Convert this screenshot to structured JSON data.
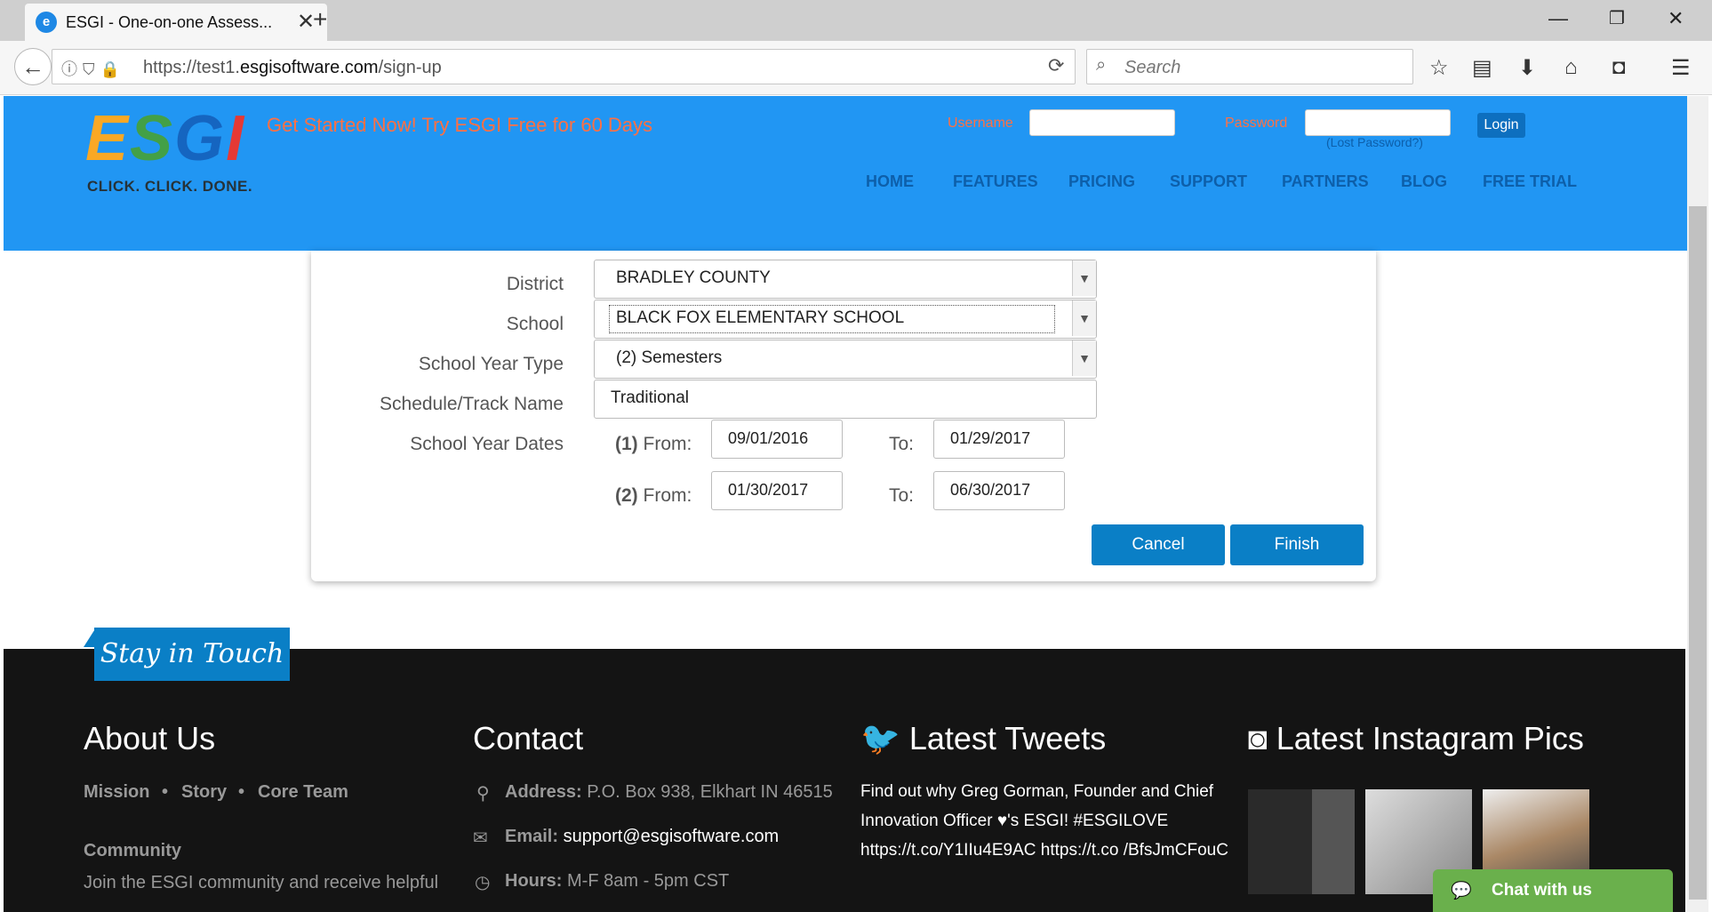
{
  "browser": {
    "tab_title": "ESGI - One-on-one Assess...",
    "url_host_prefix": "https://test1.",
    "url_host": "esgisoftware.com",
    "url_path": "/sign-up",
    "search_placeholder": "Search"
  },
  "header": {
    "logo_text": "ESGI",
    "logo_tagline": "CLICK. CLICK. DONE.",
    "promo": "Get Started Now! Try ESGI Free for 60 Days",
    "username_label": "Username",
    "password_label": "Password",
    "login_button": "Login",
    "lost_password": "(Lost Password?)",
    "nav": [
      "HOME",
      "FEATURES",
      "PRICING",
      "SUPPORT",
      "PARTNERS",
      "BLOG",
      "FREE TRIAL"
    ]
  },
  "form": {
    "district_label": "District",
    "district_value": "BRADLEY COUNTY",
    "school_label": "School",
    "school_value": "BLACK FOX ELEMENTARY SCHOOL",
    "year_type_label": "School Year Type",
    "year_type_value": "(2) Semesters",
    "track_label": "Schedule/Track Name",
    "track_value": "Traditional",
    "dates_label": "School Year Dates",
    "periods": [
      {
        "num": "(1)",
        "from_label": "From:",
        "from": "09/01/2016",
        "to_label": "To:",
        "to": "01/29/2017"
      },
      {
        "num": "(2)",
        "from_label": "From:",
        "from": "01/30/2017",
        "to_label": "To:",
        "to": "06/30/2017"
      }
    ],
    "cancel_button": "Cancel",
    "finish_button": "Finish"
  },
  "footer": {
    "stay_in_touch": "Stay in Touch",
    "about": {
      "heading": "About Us",
      "links": [
        "Mission",
        "Story",
        "Core Team"
      ],
      "community_heading": "Community",
      "community_text": "Join the ESGI community and receive helpful"
    },
    "contact": {
      "heading": "Contact",
      "address_label": "Address:",
      "address": "P.O. Box 938, Elkhart IN 46515",
      "email_label": "Email:",
      "email": "support@esgisoftware.com",
      "hours_label": "Hours:",
      "hours": "M-F 8am - 5pm CST"
    },
    "tweets": {
      "heading": "Latest Tweets",
      "tweet": "Find out why Greg Gorman, Founder and Chief Innovation Officer ♥'s ESGI! #ESGILOVE https://t.co/Y1IIu4E9AC https://t.co /BfsJmCFouC"
    },
    "instagram": {
      "heading": "Latest Instagram Pics"
    },
    "chat_button": "Chat with us"
  }
}
